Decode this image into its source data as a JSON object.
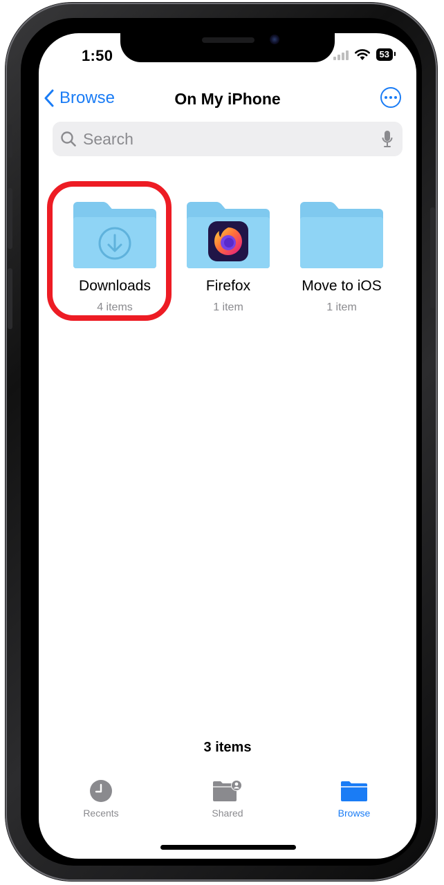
{
  "status_bar": {
    "time": "1:50",
    "battery": "53"
  },
  "nav": {
    "back_label": "Browse",
    "title": "On My iPhone",
    "more_icon": "ellipsis-circle-icon"
  },
  "search": {
    "placeholder": "Search",
    "value": ""
  },
  "folders": [
    {
      "name": "Downloads",
      "count": "4 items",
      "icon": "download-arrow-icon",
      "highlighted": true
    },
    {
      "name": "Firefox",
      "count": "1 item",
      "icon": "firefox-app-icon",
      "highlighted": false
    },
    {
      "name": "Move to iOS",
      "count": "1 item",
      "icon": "folder-icon",
      "highlighted": false
    }
  ],
  "footer": {
    "item_total": "3 items"
  },
  "tabs": [
    {
      "label": "Recents",
      "icon": "clock-icon",
      "active": false
    },
    {
      "label": "Shared",
      "icon": "shared-folder-icon",
      "active": false
    },
    {
      "label": "Browse",
      "icon": "folder-icon",
      "active": true
    }
  ],
  "colors": {
    "accent": "#1a7cf5",
    "folder": "#8fd4f5",
    "highlight": "#ed1c24",
    "secondary_text": "#8a8a8e"
  }
}
